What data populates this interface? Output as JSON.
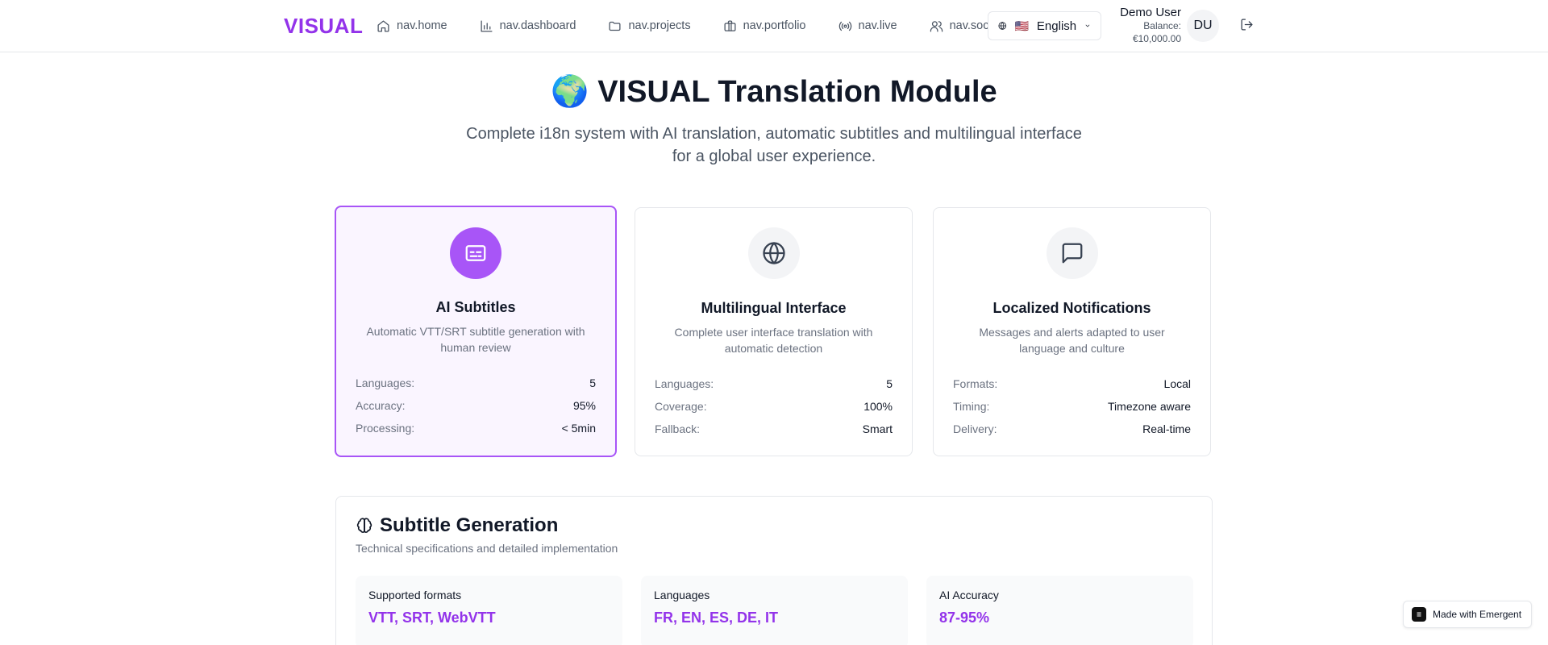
{
  "header": {
    "logo": "VISUAL",
    "nav": [
      {
        "label": "nav.home",
        "icon": "home-icon"
      },
      {
        "label": "nav.dashboard",
        "icon": "bar-chart-icon"
      },
      {
        "label": "nav.projects",
        "icon": "folder-icon"
      },
      {
        "label": "nav.portfolio",
        "icon": "briefcase-icon"
      },
      {
        "label": "nav.live",
        "icon": "radio-icon"
      },
      {
        "label": "nav.social",
        "icon": "users-icon"
      }
    ],
    "language": {
      "flag": "🇺🇸",
      "label": "English"
    },
    "user": {
      "name": "Demo User",
      "balance_label": "Balance:",
      "balance": "€10,000.00",
      "initials": "DU"
    }
  },
  "hero": {
    "emoji": "🌍",
    "title": "VISUAL Translation Module",
    "subtitle": "Complete i18n system with AI translation, automatic subtitles and multilingual interface for a global user experience."
  },
  "cards": [
    {
      "title": "AI Subtitles",
      "description": "Automatic VTT/SRT subtitle generation with human review",
      "icon": "subtitles-icon",
      "active": true,
      "stats": [
        {
          "label": "Languages:",
          "value": "5"
        },
        {
          "label": "Accuracy:",
          "value": "95%"
        },
        {
          "label": "Processing:",
          "value": "< 5min"
        }
      ]
    },
    {
      "title": "Multilingual Interface",
      "description": "Complete user interface translation with automatic detection",
      "icon": "globe-icon",
      "active": false,
      "stats": [
        {
          "label": "Languages:",
          "value": "5"
        },
        {
          "label": "Coverage:",
          "value": "100%"
        },
        {
          "label": "Fallback:",
          "value": "Smart"
        }
      ]
    },
    {
      "title": "Localized Notifications",
      "description": "Messages and alerts adapted to user language and culture",
      "icon": "message-icon",
      "active": false,
      "stats": [
        {
          "label": "Formats:",
          "value": "Local"
        },
        {
          "label": "Timing:",
          "value": "Timezone aware"
        },
        {
          "label": "Delivery:",
          "value": "Real-time"
        }
      ]
    }
  ],
  "section": {
    "title": "Subtitle Generation",
    "icon": "brain-icon",
    "subtitle": "Technical specifications and detailed implementation",
    "specs": [
      {
        "label": "Supported formats",
        "value": "VTT, SRT, WebVTT"
      },
      {
        "label": "Languages",
        "value": "FR, EN, ES, DE, IT"
      },
      {
        "label": "AI Accuracy",
        "value": "87-95%"
      }
    ]
  },
  "badge": {
    "label": "Made with Emergent"
  },
  "colors": {
    "accent": "#9333ea",
    "accent_light": "#a855f7",
    "card_active_bg": "#faf5ff"
  }
}
